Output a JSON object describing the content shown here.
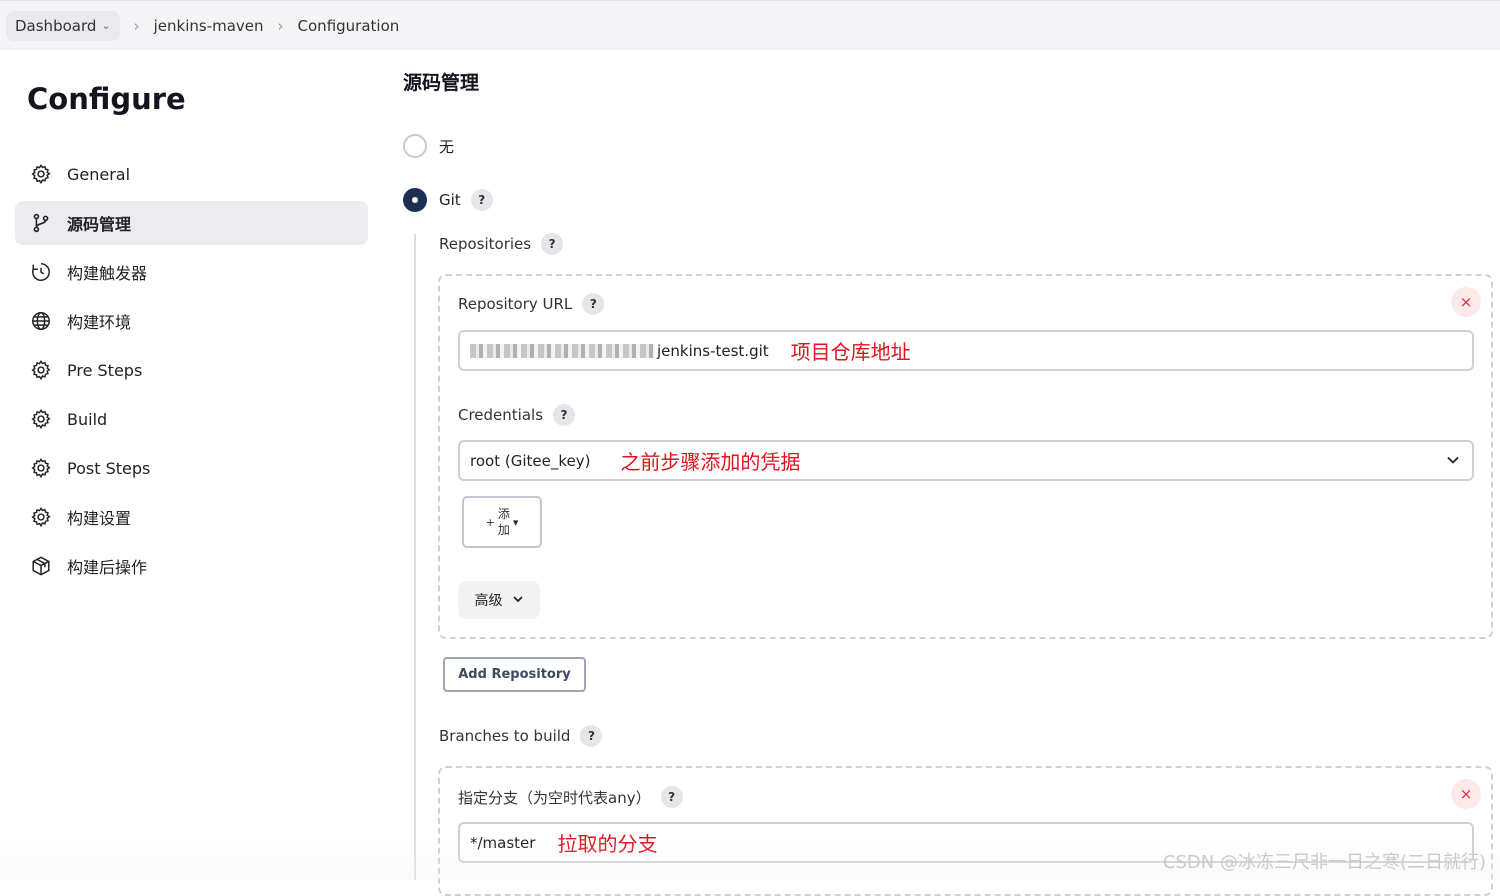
{
  "breadcrumb": {
    "items": [
      "Dashboard",
      "jenkins-maven",
      "Configuration"
    ]
  },
  "sidebar": {
    "title": "Configure",
    "items": [
      {
        "label": "General",
        "icon": "gear-icon"
      },
      {
        "label": "源码管理",
        "icon": "git-branch-icon",
        "active": true
      },
      {
        "label": "构建触发器",
        "icon": "clock-icon"
      },
      {
        "label": "构建环境",
        "icon": "globe-icon"
      },
      {
        "label": "Pre Steps",
        "icon": "gear-icon"
      },
      {
        "label": "Build",
        "icon": "gear-icon"
      },
      {
        "label": "Post Steps",
        "icon": "gear-icon"
      },
      {
        "label": "构建设置",
        "icon": "gear-icon"
      },
      {
        "label": "构建后操作",
        "icon": "package-icon"
      }
    ]
  },
  "scm": {
    "section_title": "源码管理",
    "option_none": "无",
    "option_git": "Git",
    "help_glyph": "?",
    "repositories_label": "Repositories",
    "repository_url_label": "Repository URL",
    "repository_url_value": "jenkins-test.git",
    "repository_url_annotation": "项目仓库地址",
    "credentials_label": "Credentials",
    "credentials_value": "root (Gitee_key)",
    "credentials_annotation": "之前步骤添加的凭据",
    "add_button": {
      "plus": "+",
      "line1": "添",
      "line2": "加"
    },
    "advanced_label": "高级",
    "add_repository_label": "Add Repository",
    "branches_label": "Branches to build",
    "branch_spec_label": "指定分支（为空时代表any）",
    "branch_spec_value": "*/master",
    "branch_spec_annotation": "拉取的分支",
    "remove_glyph": "×"
  },
  "watermark": "CSDN @冰冻三尺非一日之寒(二日就行)",
  "colors": {
    "accent": "#1c2e51",
    "annotation": "#e0141e",
    "remove": "#e02d3c"
  }
}
